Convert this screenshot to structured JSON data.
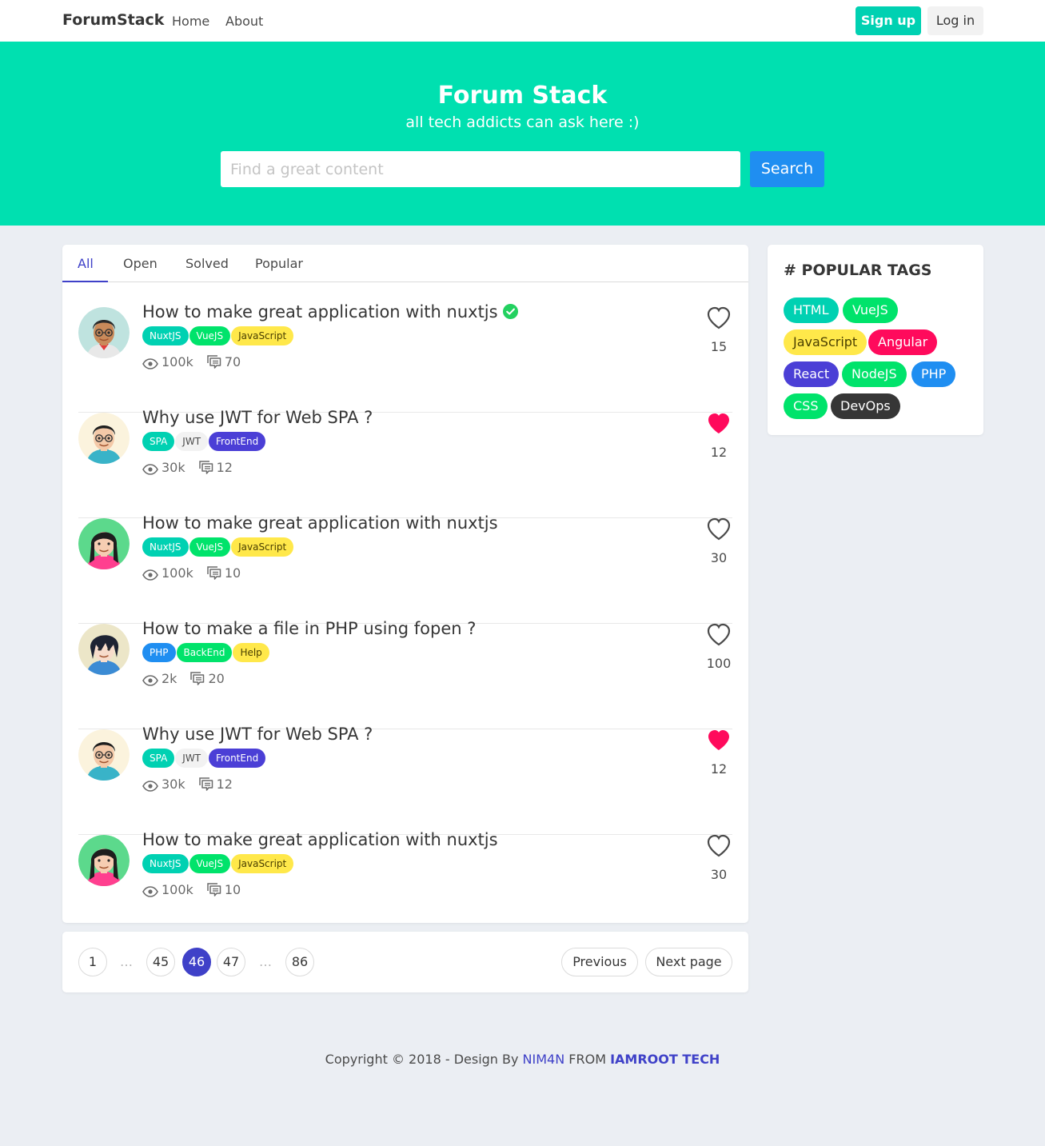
{
  "navbar": {
    "brand": "ForumStack",
    "links": [
      "Home",
      "About"
    ],
    "signup_label": "Sign up",
    "login_label": "Log in"
  },
  "hero": {
    "title": "Forum Stack",
    "subtitle": "all tech addicts can ask here :)",
    "search_placeholder": "Find a great content",
    "search_button": "Search"
  },
  "tabs": [
    "All",
    "Open",
    "Solved",
    "Popular"
  ],
  "active_tab": "All",
  "questions": [
    {
      "title": "How to make great application with nuxtjs",
      "solved": true,
      "avatar": "boy-glasses",
      "tags": [
        {
          "label": "NuxtJS",
          "color": "#00d1b2",
          "text": "#ffffff"
        },
        {
          "label": "VueJS",
          "color": "#00e36b",
          "text": "#ffffff"
        },
        {
          "label": "JavaScript",
          "color": "#ffe84a",
          "text": "#4a3f00"
        }
      ],
      "views": "100k",
      "comments": "70",
      "liked": false,
      "likes": "15"
    },
    {
      "title": "Why use JWT for Web SPA ?",
      "solved": false,
      "avatar": "person-glasses",
      "tags": [
        {
          "label": "SPA",
          "color": "#00d1b2",
          "text": "#ffffff"
        },
        {
          "label": "JWT",
          "color": "#f2f2f2",
          "text": "#4a4a4a"
        },
        {
          "label": "FrontEnd",
          "color": "#4b3fd6",
          "text": "#ffffff"
        }
      ],
      "views": "30k",
      "comments": "12",
      "liked": true,
      "likes": "12"
    },
    {
      "title": "How to make great application with nuxtjs",
      "solved": false,
      "avatar": "woman",
      "tags": [
        {
          "label": "NuxtJS",
          "color": "#00d1b2",
          "text": "#ffffff"
        },
        {
          "label": "VueJS",
          "color": "#00e36b",
          "text": "#ffffff"
        },
        {
          "label": "JavaScript",
          "color": "#ffe84a",
          "text": "#4a3f00"
        }
      ],
      "views": "100k",
      "comments": "10",
      "liked": false,
      "likes": "30"
    },
    {
      "title": "How to make a file in PHP using fopen ?",
      "solved": false,
      "avatar": "anime",
      "tags": [
        {
          "label": "PHP",
          "color": "#1f8ef1",
          "text": "#ffffff"
        },
        {
          "label": "BackEnd",
          "color": "#00e36b",
          "text": "#ffffff"
        },
        {
          "label": "Help",
          "color": "#ffe84a",
          "text": "#4a3f00"
        }
      ],
      "views": "2k",
      "comments": "20",
      "liked": false,
      "likes": "100"
    },
    {
      "title": "Why use JWT for Web SPA ?",
      "solved": false,
      "avatar": "person-glasses",
      "tags": [
        {
          "label": "SPA",
          "color": "#00d1b2",
          "text": "#ffffff"
        },
        {
          "label": "JWT",
          "color": "#f2f2f2",
          "text": "#4a4a4a"
        },
        {
          "label": "FrontEnd",
          "color": "#4b3fd6",
          "text": "#ffffff"
        }
      ],
      "views": "30k",
      "comments": "12",
      "liked": true,
      "likes": "12"
    },
    {
      "title": "How to make great application with nuxtjs",
      "solved": false,
      "avatar": "woman",
      "tags": [
        {
          "label": "NuxtJS",
          "color": "#00d1b2",
          "text": "#ffffff"
        },
        {
          "label": "VueJS",
          "color": "#00e36b",
          "text": "#ffffff"
        },
        {
          "label": "JavaScript",
          "color": "#ffe84a",
          "text": "#4a3f00"
        }
      ],
      "views": "100k",
      "comments": "10",
      "liked": false,
      "likes": "30"
    }
  ],
  "pagination": {
    "pages": [
      "1",
      "45",
      "46",
      "47",
      "86"
    ],
    "current": "46",
    "ellipsis": "…",
    "previous_label": "Previous",
    "next_label": "Next page"
  },
  "sidebar": {
    "title": "# POPULAR TAGS",
    "tags": [
      {
        "label": "HTML",
        "color": "#00d1b2",
        "text": "#ffffff"
      },
      {
        "label": "VueJS",
        "color": "#00e36b",
        "text": "#ffffff"
      },
      {
        "label": "JavaScript",
        "color": "#ffe84a",
        "text": "#4a3f00"
      },
      {
        "label": "Angular",
        "color": "#ff0a5c",
        "text": "#ffffff"
      },
      {
        "label": "React",
        "color": "#4b3fd6",
        "text": "#ffffff"
      },
      {
        "label": "NodeJS",
        "color": "#00e36b",
        "text": "#ffffff"
      },
      {
        "label": "PHP",
        "color": "#1f8ef1",
        "text": "#ffffff"
      },
      {
        "label": "CSS",
        "color": "#00e36b",
        "text": "#ffffff"
      },
      {
        "label": "DevOps",
        "color": "#363636",
        "text": "#ffffff"
      }
    ]
  },
  "footer": {
    "prefix": "Copyright © 2018 - Design By ",
    "author": "NIM4N",
    "middle": " FROM ",
    "company": "IAMROOT TECH"
  },
  "colors": {
    "primary": "#00d1b2",
    "hero": "#00e0b0",
    "link": "#1f8ef1",
    "accent": "#3f41c8",
    "heart": "#ff0a5c",
    "solved": "#23d160"
  }
}
